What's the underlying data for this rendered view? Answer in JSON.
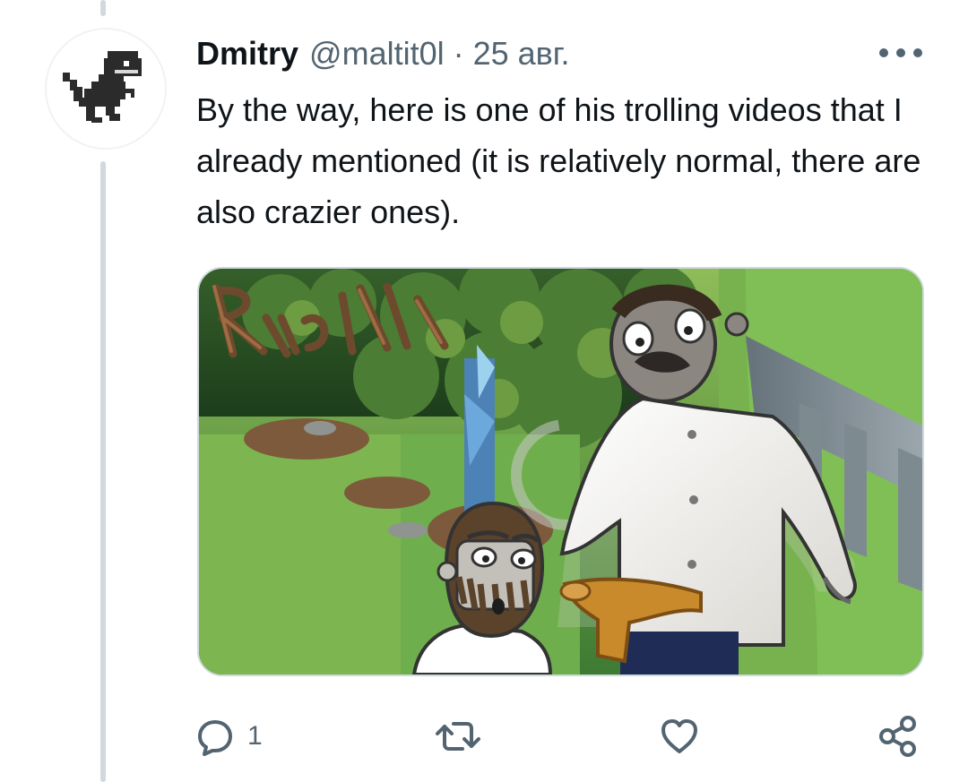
{
  "author": {
    "display_name": "Dmitry",
    "handle": "@maltit0l",
    "separator": "·",
    "date": "25 авг."
  },
  "tweet": {
    "text": "By the way, here is one of his trolling videos that I already mentioned (it is relatively normal, there are also crazier ones)."
  },
  "media": {
    "overlay_text": "Regalia"
  },
  "actions": {
    "reply_count": "1"
  },
  "icons": {
    "avatar": "dinosaur-pixel-icon",
    "more": "more-horizontal-icon",
    "reply": "reply-bubble-icon",
    "retweet": "retweet-icon",
    "like": "heart-icon",
    "share": "share-icon"
  },
  "colors": {
    "text": "#0f1419",
    "secondary_text": "#536471",
    "thread_line": "#cfd9de"
  }
}
